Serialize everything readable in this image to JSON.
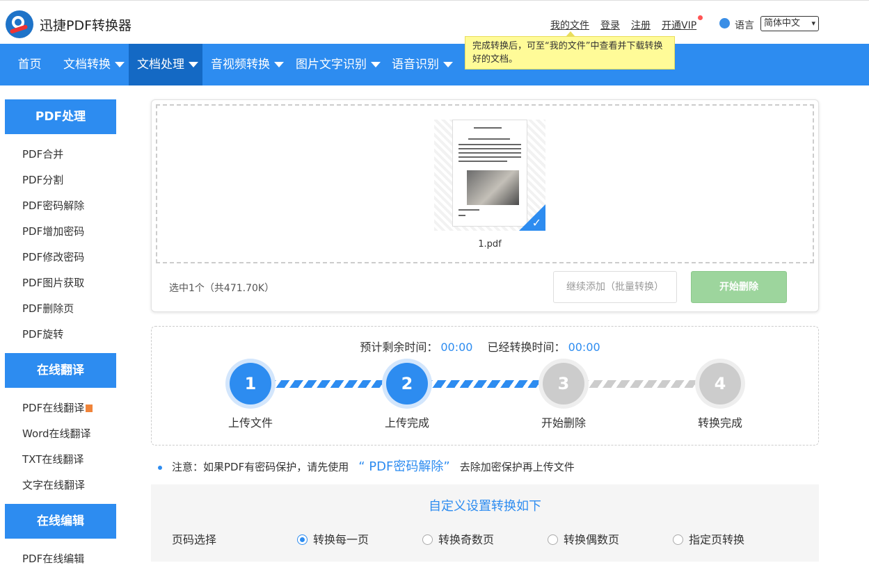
{
  "header": {
    "brand": "迅捷PDF转换器",
    "links": [
      "我的文件",
      "登录",
      "注册",
      "开通VIP"
    ],
    "lang_label": "语言",
    "lang_value": "简体中文",
    "tooltip": "完成转换后，可至“我的文件”中查看并下载转换好的文档。"
  },
  "nav": {
    "items": [
      "首页",
      "文档转换",
      "文档处理",
      "音视频转换",
      "图片文字识别",
      "语音识别"
    ],
    "active": "文档处理"
  },
  "sidebar": {
    "sections": [
      {
        "title": "PDF处理",
        "items": [
          "PDF合并",
          "PDF分割",
          "PDF密码解除",
          "PDF增加密码",
          "PDF修改密码",
          "PDF图片获取",
          "PDF删除页",
          "PDF旋转"
        ]
      },
      {
        "title": "在线翻译",
        "items": [
          "PDF在线翻译",
          "Word在线翻译",
          "TXT在线翻译",
          "文字在线翻译"
        ]
      },
      {
        "title": "在线编辑",
        "items": [
          "PDF在线编辑"
        ]
      }
    ]
  },
  "upload": {
    "file_name": "1.pdf",
    "selected_count": "选中1个（共471.70K）",
    "add_button": "继续添加（批量转换）",
    "start_button": "开始删除"
  },
  "progress": {
    "remaining_label": "预计剩余时间：",
    "remaining_value": "00:00",
    "elapsed_label": "已经转换时间：",
    "elapsed_value": "00:00",
    "steps": [
      {
        "num": "1",
        "label": "上传文件",
        "done": true
      },
      {
        "num": "2",
        "label": "上传完成",
        "done": true
      },
      {
        "num": "3",
        "label": "开始删除",
        "done": false
      },
      {
        "num": "4",
        "label": "转换完成",
        "done": false
      }
    ]
  },
  "notice": {
    "prefix": "注意：如果PDF有密码保护，请先使用",
    "link": "“ PDF密码解除”",
    "suffix": "去除加密保护再上传文件"
  },
  "settings": {
    "title": "自定义设置转换如下",
    "page_label": "页码选择",
    "options": [
      "转换每一页",
      "转换奇数页",
      "转换偶数页",
      "指定页转换"
    ],
    "selected": "转换每一页"
  },
  "colors": {
    "primary": "#2d8cf0",
    "nav_active": "#1469c4",
    "start_btn": "#9dd59d",
    "tooltip": "#fffb98"
  }
}
